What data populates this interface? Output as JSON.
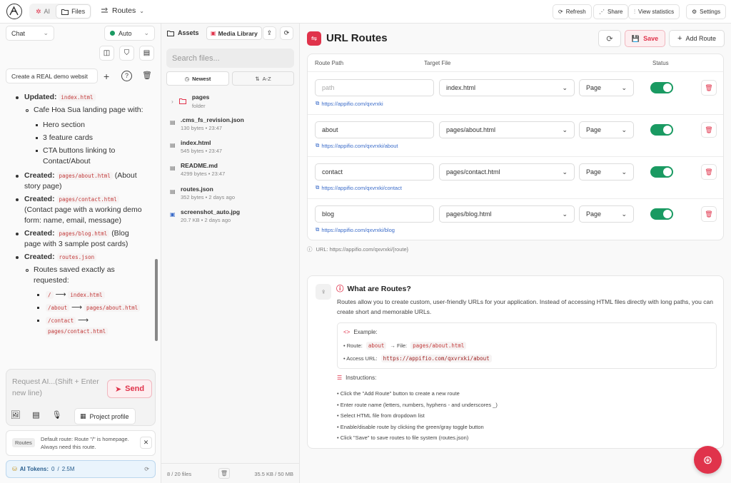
{
  "topbar": {
    "tab_ai": "AI",
    "tab_files": "Files",
    "project_name": "Routes",
    "refresh": "Refresh",
    "share": "Share",
    "view_statistics": "View statistics",
    "settings": "Settings"
  },
  "left": {
    "mode_select": "Chat",
    "model_select": "Auto",
    "prompt_select": "Create a REAL demo websit",
    "chat": {
      "updated_label": "Updated:",
      "updated_file": "index.html",
      "landing_text": "Cafe Hoa Sua landing page with:",
      "hero": "Hero section",
      "feature": "3 feature cards",
      "cta": "CTA buttons linking to Contact/About",
      "created": "Created:",
      "about_file": "pages/about.html",
      "about_desc": "(About story page)",
      "contact_file": "pages/contact.html",
      "contact_desc": "(Contact page with a working demo form: name, email, message)",
      "blog_file": "pages/blog.html",
      "blog_desc": "(Blog page with 3 sample post cards)",
      "routes_file": "routes.json",
      "routes_saved": "Routes saved exactly as requested:",
      "r1_from": "/",
      "r1_to": "index.html",
      "r2_from": "/about",
      "r2_to": "pages/about.html",
      "r3_from": "/contact",
      "r3_to": "pages/contact.html",
      "arrow": "⟶"
    },
    "input_placeholder": "Request AI...(Shift + Enter new line)",
    "send": "Send",
    "project_profile": "Project profile",
    "notice_tag": "Routes",
    "notice_text": "Default route: Route \"/\" is homepage. Always need this route.",
    "tokens_label": "AI Tokens:",
    "tokens_used": "0",
    "tokens_sep": "/",
    "tokens_total": "2.5M"
  },
  "mid": {
    "assets": "Assets",
    "media_library": "Media Library",
    "search_placeholder": "Search files...",
    "sort_newest": "Newest",
    "sort_az": "A-Z",
    "folder_name": "pages",
    "folder_label": "folder",
    "files": [
      {
        "name": ".cms_fs_revision.json",
        "meta": "130 bytes • 23:47"
      },
      {
        "name": "index.html",
        "meta": "545 bytes • 23:47"
      },
      {
        "name": "README.md",
        "meta": "4299 bytes • 23:47"
      },
      {
        "name": "routes.json",
        "meta": "352 bytes • 2 days ago"
      },
      {
        "name": "screenshot_auto.jpg",
        "meta": "20.7 KB • 2 days ago"
      }
    ],
    "file_count": "8 / 20 files",
    "storage": "35.5 KB / 50 MB"
  },
  "main": {
    "title": "URL Routes",
    "save": "Save",
    "add_route": "Add Route",
    "col_path": "Route Path",
    "col_file": "Target File",
    "col_status": "Status",
    "routes": [
      {
        "path": "",
        "placeholder": "path",
        "file": "index.html",
        "type": "Page",
        "url": "https://appifio.com/qxvrxki"
      },
      {
        "path": "about",
        "placeholder": "",
        "file": "pages/about.html",
        "type": "Page",
        "url": "https://appifio.com/qxvrxki/about"
      },
      {
        "path": "contact",
        "placeholder": "",
        "file": "pages/contact.html",
        "type": "Page",
        "url": "https://appifio.com/qxvrxki/contact"
      },
      {
        "path": "blog",
        "placeholder": "",
        "file": "pages/blog.html",
        "type": "Page",
        "url": "https://appifio.com/qxvrxki/blog"
      }
    ],
    "url_hint": "URL: https://appifio.com/qxvrxki/{route}",
    "info": {
      "title": "What are Routes?",
      "desc": "Routes allow you to create custom, user-friendly URLs for your application. Instead of accessing HTML files directly with long paths, you can create short and memorable URLs.",
      "example_label": "Example:",
      "route_label": "• Route:",
      "route_value": "about",
      "file_arrow": "→ File:",
      "file_value": "pages/about.html",
      "access_label": "• Access URL:",
      "access_value": "https://appifio.com/qxvrxki/about",
      "instructions_label": "Instructions:",
      "steps": [
        "Click the \"Add Route\" button to create a new route",
        "Enter route name (letters, numbers, hyphens - and underscores _)",
        "Select HTML file from dropdown list",
        "Enable/disable route by clicking the green/gray toggle button",
        "Click \"Save\" to save routes to file system (routes.json)"
      ]
    }
  },
  "colors": {
    "accent": "#e0334b",
    "toggle_on": "#1a9a62",
    "link": "#3b6cc9"
  }
}
